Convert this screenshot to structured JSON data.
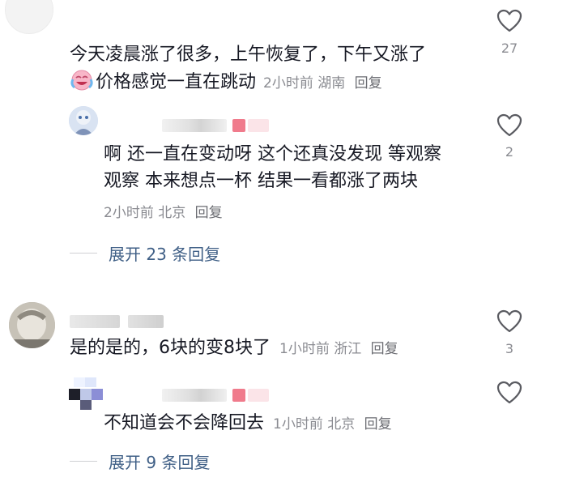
{
  "comments": [
    {
      "text_line1": "今天凌晨涨了很多，上午恢复了，下午又涨了",
      "text_line2": "价格感觉一直在跳动",
      "time": "2小时前",
      "location": "湖南",
      "reply_label": "回复",
      "likes": "27"
    },
    {
      "text_line1": "啊 还一直在变动呀 这个还真没发现 等观察",
      "text_line2": "观察 本来想点一杯 结果一看都涨了两块",
      "time": "2小时前",
      "location": "北京",
      "reply_label": "回复",
      "likes": "2"
    },
    {
      "text": "是的是的，6块的变8块了",
      "time": "1小时前",
      "location": "浙江",
      "reply_label": "回复",
      "likes": "3"
    },
    {
      "text": "不知道会不会降回去",
      "time": "1小时前",
      "location": "北京",
      "reply_label": "回复"
    }
  ],
  "expand_replies": [
    {
      "label": "展开 23 条回复"
    },
    {
      "label": "展开 9 条回复"
    }
  ],
  "icons": {
    "like": "heart-outline-icon",
    "emoji": "crying-laugh-emoji-icon"
  },
  "colors": {
    "text": "#161823",
    "meta": "#8a8b91",
    "expand": "#3f5f86",
    "heart_stroke": "#5a5b61"
  }
}
